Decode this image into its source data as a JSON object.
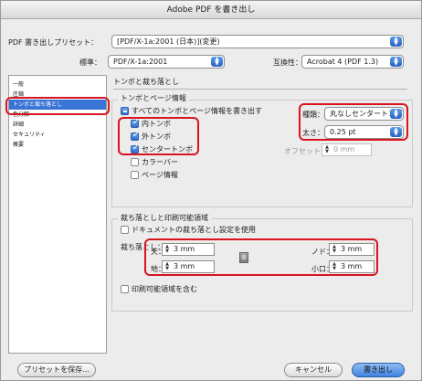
{
  "window": {
    "title": "Adobe PDF を書き出し"
  },
  "preset": {
    "label": "PDF 書き出しプリセット：",
    "value": "[PDF/X-1a:2001 (日本)](変更)"
  },
  "standard": {
    "label": "標準：",
    "value": "PDF/X-1a:2001"
  },
  "compat": {
    "label": "互換性：",
    "value": "Acrobat 4 (PDF 1.3)"
  },
  "sidebar": {
    "items": [
      {
        "label": "一般"
      },
      {
        "label": "圧縮"
      },
      {
        "label": "トンボと裁ち落とし"
      },
      {
        "label": "色分解"
      },
      {
        "label": "詳細"
      },
      {
        "label": "セキュリティ"
      },
      {
        "label": "概要"
      }
    ],
    "selected_index": 2
  },
  "panel": {
    "title": "トンボと裁ち落とし"
  },
  "marks": {
    "group_title": "トンボとページ情報",
    "all_marks": "すべてのトンボとページ情報を書き出す",
    "crop": "内トンボ",
    "bleed": "外トンボ",
    "registration": "センタートンボ",
    "color_bars": "カラーバー",
    "page_info": "ページ情報",
    "type_label": "種類：",
    "type_value": "丸なしセンタートンボ",
    "weight_label": "太さ：",
    "weight_value": "0.25 pt",
    "offset_label": "オフセット：",
    "offset_value": "0 mm"
  },
  "bleed": {
    "group_title": "裁ち落としと印刷可能領域",
    "use_doc": "ドキュメントの裁ち落とし設定を使用",
    "bleed_label": "裁ち落とし：",
    "top_label": "天：",
    "top_value": "3 mm",
    "bottom_label": "地：",
    "bottom_value": "3 mm",
    "inside_label": "ノド：",
    "inside_value": "3 mm",
    "outside_label": "小口：",
    "outside_value": "3 mm",
    "link_icon_glyph": "8",
    "include_slug": "印刷可能領域を含む"
  },
  "buttons": {
    "save_preset": "プリセットを保存...",
    "cancel": "キャンセル",
    "export": "書き出し"
  },
  "colors": {
    "highlight": "#d8141e",
    "accent": "#3875d7"
  }
}
